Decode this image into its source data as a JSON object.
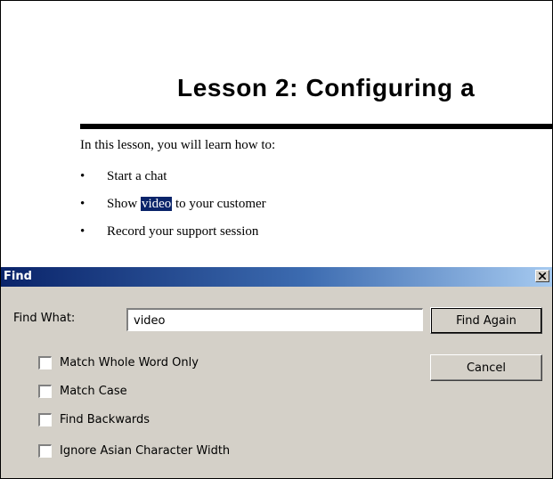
{
  "document": {
    "title": "Lesson 2: Configuring a",
    "intro": "In this lesson, you will learn how to:",
    "items": [
      {
        "bullet": "•",
        "text": "Start a chat"
      },
      {
        "bullet": "•",
        "before": "Show ",
        "highlight": "video",
        "after": " to your customer"
      },
      {
        "bullet": "•",
        "text": "Record your support session"
      }
    ]
  },
  "dialog": {
    "title": "Find",
    "close_label": "Close",
    "find_what_label": "Find What:",
    "find_value": "video",
    "find_again_label": "Find Again",
    "cancel_label": "Cancel",
    "options": [
      {
        "label": "Match Whole Word Only",
        "checked": false
      },
      {
        "label": "Match Case",
        "checked": false
      },
      {
        "label": "Find Backwards",
        "checked": false
      },
      {
        "label": "Ignore Asian Character Width",
        "checked": false
      }
    ]
  },
  "colors": {
    "highlight_bg": "#0a246a",
    "titlebar_start": "#0a246a",
    "titlebar_end": "#a6caf0",
    "dialog_bg": "#d4d0c8"
  }
}
